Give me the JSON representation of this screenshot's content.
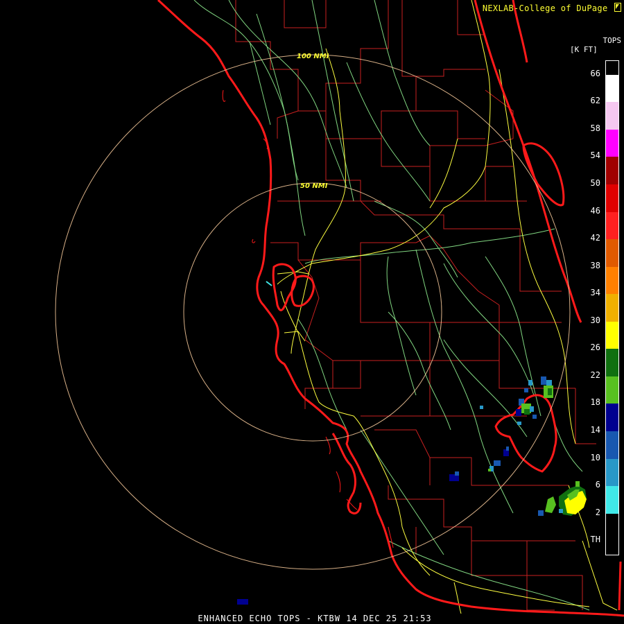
{
  "credit": "NEXLAB-College of DuPage",
  "credit_icon": "cursor-arrow-icon",
  "product_title": "ENHANCED ECHO TOPS - KTBW 14 DEC 25 21:53",
  "scale": {
    "title_line1": "TOPS",
    "title_line2": "[K FT]",
    "labels": [
      "66",
      "62",
      "58",
      "54",
      "50",
      "46",
      "42",
      "38",
      "34",
      "30",
      "26",
      "22",
      "18",
      "14",
      "10",
      "6",
      "2",
      "TH"
    ],
    "colors": [
      "#ffffff",
      "#f5c8f0",
      "#ff00ff",
      "#a00000",
      "#e00000",
      "#ff2020",
      "#e05a00",
      "#ff8000",
      "#f0b000",
      "#ffff00",
      "#107010",
      "#58c020",
      "#000090",
      "#1858b0",
      "#2898c8",
      "#40e8e8",
      "#000000"
    ]
  },
  "range_rings": [
    {
      "label": "100 NMI"
    },
    {
      "label": "50 NMI"
    }
  ],
  "colors": {
    "coastline": "#ff1a1a",
    "county": "#c82020",
    "highway": "#ffff40",
    "river": "#90ee90",
    "ring": "#ffd0a0",
    "text_yellow": "#ffff33"
  }
}
